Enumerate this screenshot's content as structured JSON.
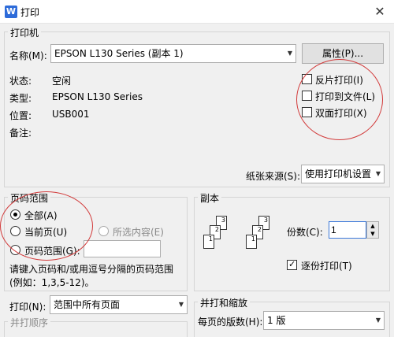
{
  "window": {
    "title": "打印",
    "app_icon": "W"
  },
  "printer": {
    "group_label": "打印机",
    "name_label": "名称(M):",
    "name_value": "EPSON L130 Series (副本 1)",
    "properties_button": "属性(P)...",
    "status_label": "状态:",
    "status_value": "空闲",
    "type_label": "类型:",
    "type_value": "EPSON L130 Series",
    "where_label": "位置:",
    "where_value": "USB001",
    "comment_label": "备注:",
    "reverse_print": "反片打印(I)",
    "print_to_file": "打印到文件(L)",
    "duplex": "双面打印(X)",
    "paper_source_label": "纸张来源(S):",
    "paper_source_value": "使用打印机设置"
  },
  "page_range": {
    "group_label": "页码范围",
    "all": "全部(A)",
    "current": "当前页(U)",
    "selection": "所选内容(E)",
    "pages": "页码范围(G):",
    "pages_value": "",
    "hint_line1": "请键入页码和/或用逗号分隔的页码范围",
    "hint_line2": "(例如：1,3,5-12)。"
  },
  "copies": {
    "group_label": "副本",
    "count_label": "份数(C):",
    "count_value": "1",
    "collate": "逐份打印(T)",
    "collate_checked": true
  },
  "print_what": {
    "label": "打印(N):",
    "value": "范围中所有页面"
  },
  "collate_order": {
    "group_label": "并打顺序"
  },
  "zoom": {
    "group_label": "并打和缩放",
    "pages_per_sheet_label": "每页的版数(H):",
    "pages_per_sheet_value": "1 版"
  },
  "colors": {
    "accent": "#2d6bd9",
    "annotation": "#d23b3b"
  }
}
